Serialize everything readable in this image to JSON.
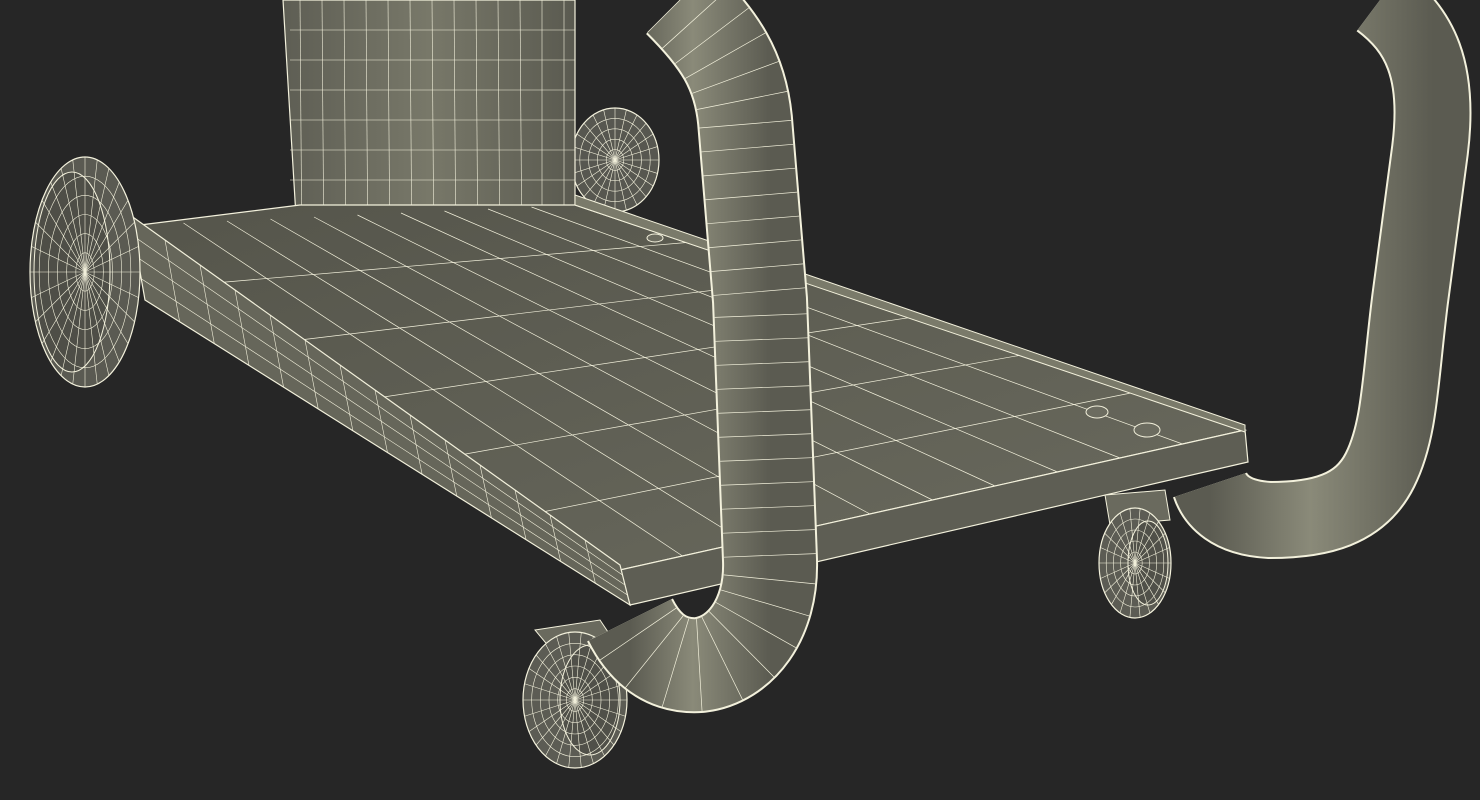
{
  "scene": {
    "subject": "welding-cart-wireframe",
    "background_color": "#262626",
    "surface_color": "#6f6f63",
    "surface_dark_color": "#4f4f46",
    "wire_color": "#f3f1dc",
    "components": [
      "machine-column",
      "cart-tray",
      "rear-wheel-left",
      "rear-wheel-right",
      "handle-bar",
      "front-caster-left",
      "front-caster-right"
    ]
  }
}
